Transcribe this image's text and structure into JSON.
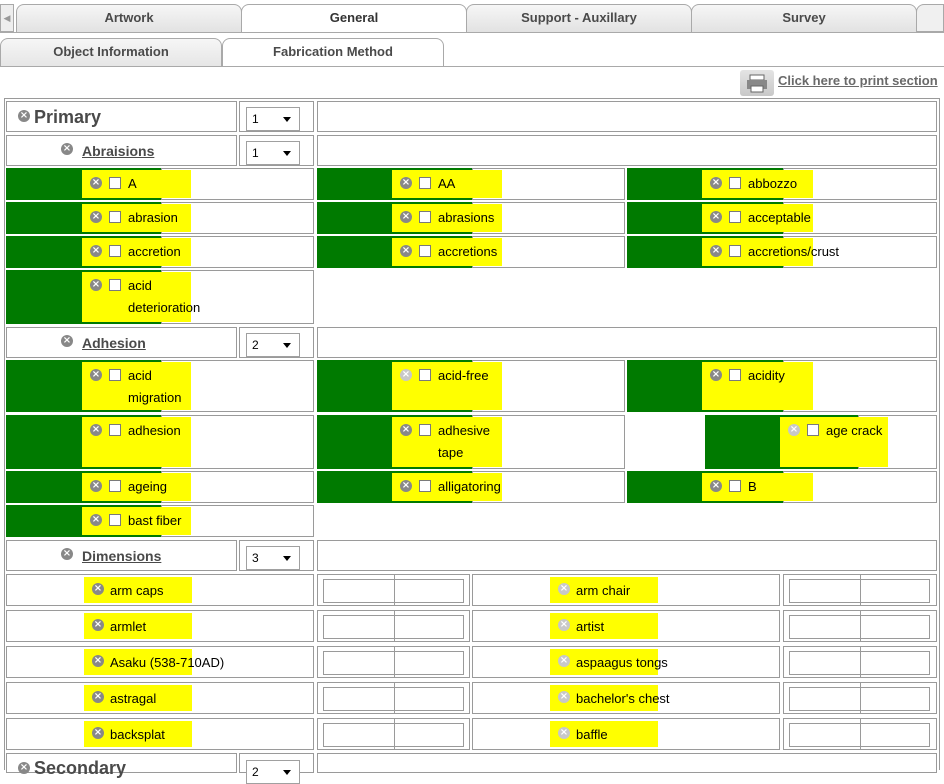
{
  "tabs": [
    "Artwork",
    "General",
    "Support - Auxillary",
    "Survey"
  ],
  "subtabs": [
    "Object Information",
    "Fabrication Method"
  ],
  "print_label": "Click here to print section",
  "primary": {
    "title": "Primary",
    "count": "1"
  },
  "secondary": {
    "title": "Secondary",
    "count": "2"
  },
  "sections": [
    {
      "title": "Abraisions",
      "count": "1",
      "items": [
        "A",
        "AA",
        "abbozzo",
        "abrasion",
        "abrasions",
        "acceptable",
        "accretion",
        "accretions",
        "accretions/crust",
        "acid deterioration"
      ]
    },
    {
      "title": "Adhesion",
      "count": "2",
      "items": [
        "acid migration",
        "acid-free",
        "acidity",
        "adhesion",
        "adhesive tape",
        "age crack",
        "ageing",
        "alligatoring",
        "B",
        "bast fiber"
      ]
    },
    {
      "title": "Dimensions",
      "count": "3",
      "items": [
        "arm caps",
        "arm chair",
        "armlet",
        "artist",
        "Asaku (538-710AD)",
        "aspaagus tongs",
        "astragal",
        "bachelor's chest",
        "backsplat",
        "baffle"
      ]
    }
  ]
}
